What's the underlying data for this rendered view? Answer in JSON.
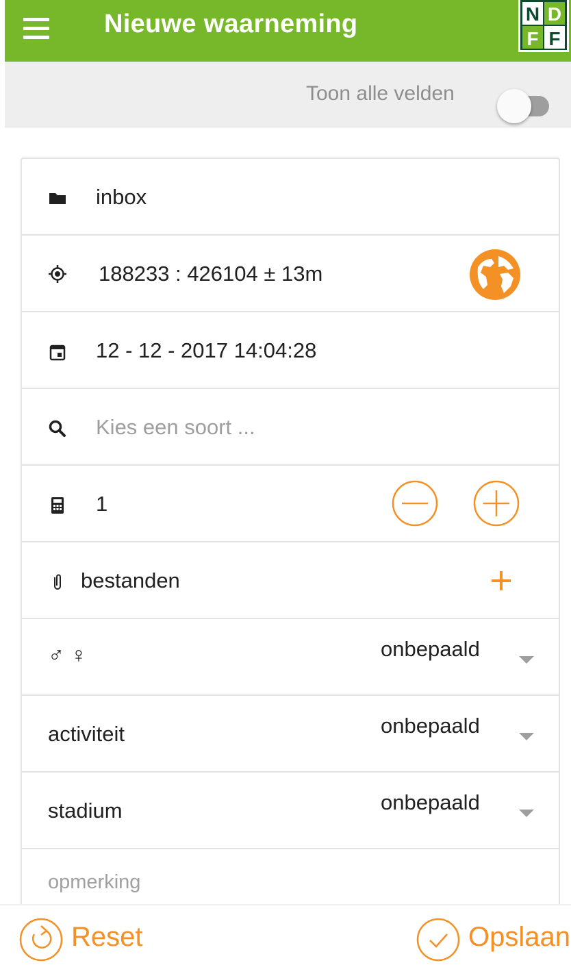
{
  "header": {
    "title": "Nieuwe waarneming",
    "logo_text": "NDFF",
    "bar_color": "#76b82a"
  },
  "toggle": {
    "label": "Toon alle velden",
    "checked": false
  },
  "form": {
    "folder": {
      "icon": "folder-icon",
      "value": "inbox"
    },
    "location": {
      "icon": "crosshair-icon",
      "value": "188233 : 426104 ± 13m",
      "action_icon": "globe-icon"
    },
    "date": {
      "icon": "calendar-icon",
      "value": "12 - 12 - 2017 14:04:28"
    },
    "species": {
      "icon": "search-icon",
      "placeholder": "Kies een soort ..."
    },
    "count": {
      "icon": "calculator-icon",
      "value": "1"
    },
    "files": {
      "icon": "paperclip-icon",
      "label": "bestanden"
    },
    "sex": {
      "symbols": "♂ ♀",
      "value": "onbepaald"
    },
    "activity": {
      "label": "activiteit",
      "value": "onbepaald"
    },
    "stage": {
      "label": "stadium",
      "value": "onbepaald"
    },
    "comment": {
      "placeholder": "opmerking"
    }
  },
  "footer": {
    "reset_label": "Reset",
    "save_label": "Opslaan"
  },
  "colors": {
    "accent": "#f39026",
    "brand_green": "#76b82a",
    "logo_dark": "#0d4a2e"
  }
}
